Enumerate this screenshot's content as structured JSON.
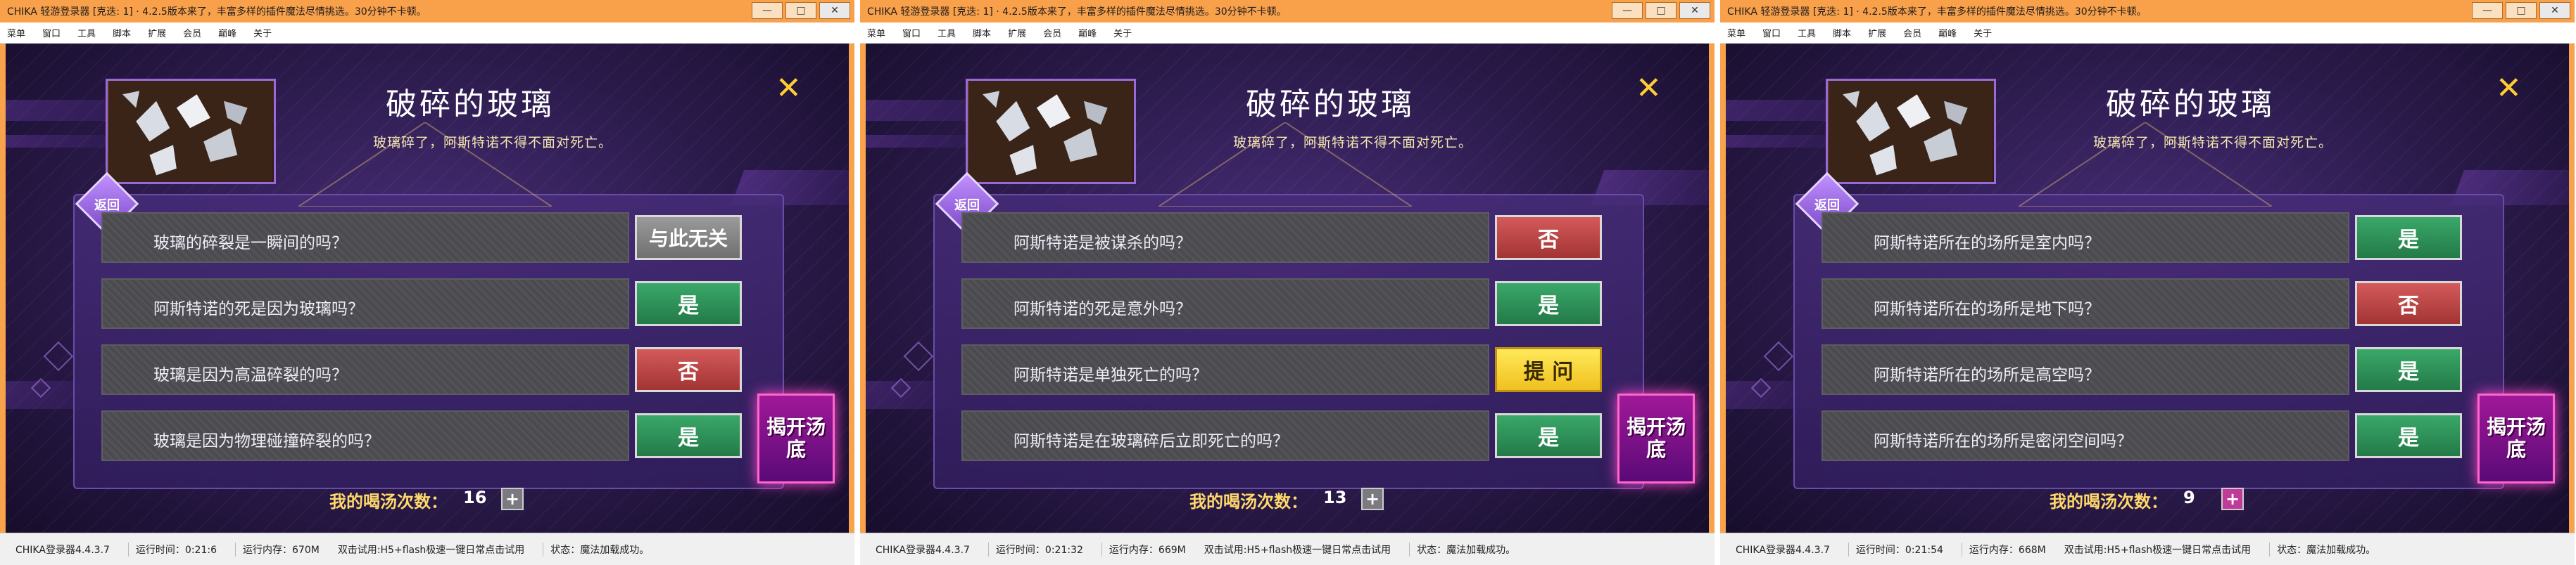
{
  "windows": [
    {
      "title": "CHIKA 轻游登录器 [克迭: 1] · 4.2.5版本来了，丰富多样的插件魔法尽情挑选。30分钟不卡顿。",
      "menu": [
        "菜单",
        "窗口",
        "工具",
        "脚本",
        "扩展",
        "会员",
        "巅峰",
        "关于"
      ],
      "game": {
        "title": "破碎的玻璃",
        "subtitle": "玻璃碎了，阿斯特诺不得不面对死亡。",
        "back_label": "返回",
        "rows": [
          {
            "question": "玻璃的碎裂是一瞬间的吗？",
            "answer": "与此无关",
            "type": "irrelevant"
          },
          {
            "question": "阿斯特诺的死是因为玻璃吗？",
            "answer": "是",
            "type": "yes"
          },
          {
            "question": "玻璃是因为高温碎裂的吗？",
            "answer": "否",
            "type": "no"
          },
          {
            "question": "玻璃是因为物理碰撞碎裂的吗？",
            "answer": "是",
            "type": "yes"
          }
        ],
        "reveal_label": "揭开汤底",
        "count_label": "我的喝汤次数：",
        "count": "16",
        "plus": "+"
      },
      "status": {
        "app": "CHIKA登录器4.4.3.7",
        "runtime": "运行时间：0:21:6",
        "memory": "运行内存：670M",
        "tip": "双击试用:H5+flash极速一键日常点击试用",
        "state": "状态：魔法加载成功。"
      }
    },
    {
      "title": "CHIKA 轻游登录器 [克迭: 1] · 4.2.5版本来了，丰富多样的插件魔法尽情挑选。30分钟不卡顿。",
      "menu": [
        "菜单",
        "窗口",
        "工具",
        "脚本",
        "扩展",
        "会员",
        "巅峰",
        "关于"
      ],
      "game": {
        "title": "破碎的玻璃",
        "subtitle": "玻璃碎了，阿斯特诺不得不面对死亡。",
        "back_label": "返回",
        "rows": [
          {
            "question": "阿斯特诺是被谋杀的吗？",
            "answer": "否",
            "type": "no"
          },
          {
            "question": "阿斯特诺的死是意外吗？",
            "answer": "是",
            "type": "yes"
          },
          {
            "question": "阿斯特诺是单独死亡的吗？",
            "answer": "提 问",
            "type": "ask"
          },
          {
            "question": "阿斯特诺是在玻璃碎后立即死亡的吗？",
            "answer": "是",
            "type": "yes"
          }
        ],
        "reveal_label": "揭开汤底",
        "count_label": "我的喝汤次数：",
        "count": "13",
        "plus": "+"
      },
      "status": {
        "app": "CHIKA登录器4.4.3.7",
        "runtime": "运行时间：0:21:32",
        "memory": "运行内存：669M",
        "tip": "双击试用:H5+flash极速一键日常点击试用",
        "state": "状态：魔法加载成功。"
      }
    },
    {
      "title": "CHIKA 轻游登录器 [克迭: 1] · 4.2.5版本来了，丰富多样的插件魔法尽情挑选。30分钟不卡顿。",
      "menu": [
        "菜单",
        "窗口",
        "工具",
        "脚本",
        "扩展",
        "会员",
        "巅峰",
        "关于"
      ],
      "game": {
        "title": "破碎的玻璃",
        "subtitle": "玻璃碎了，阿斯特诺不得不面对死亡。",
        "back_label": "返回",
        "rows": [
          {
            "question": "阿斯特诺所在的场所是室内吗？",
            "answer": "是",
            "type": "yes"
          },
          {
            "question": "阿斯特诺所在的场所是地下吗？",
            "answer": "否",
            "type": "no"
          },
          {
            "question": "阿斯特诺所在的场所是高空吗？",
            "answer": "是",
            "type": "yes"
          },
          {
            "question": "阿斯特诺所在的场所是密闭空间吗？",
            "answer": "是",
            "type": "yes"
          }
        ],
        "reveal_label": "揭开汤底",
        "count_label": "我的喝汤次数：",
        "count": "9",
        "plus": "+"
      },
      "status": {
        "app": "CHIKA登录器4.4.3.7",
        "runtime": "运行时间：0:21:54",
        "memory": "运行内存：668M",
        "tip": "双击试用:H5+flash极速一键日常点击试用",
        "state": "状态：魔法加载成功。"
      }
    }
  ],
  "titlebar_buttons": [
    "—",
    "□",
    "✕"
  ],
  "colors": {
    "titlebar": "#f9a04a",
    "yes": "#2e9058",
    "no": "#c04444",
    "ask": "#f5d53a",
    "irrelevant": "#888888",
    "reveal": "#a01898"
  }
}
